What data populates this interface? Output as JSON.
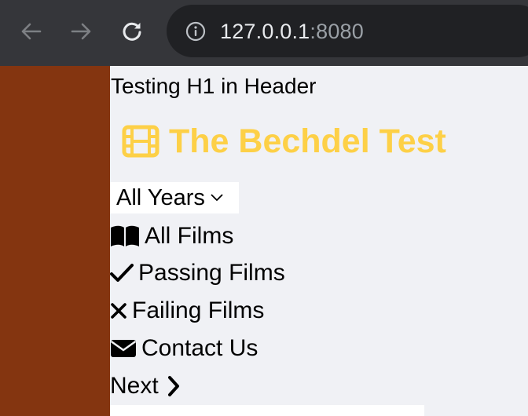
{
  "browser": {
    "url_host": "127.0.0.1",
    "url_port": ":8080"
  },
  "page": {
    "header_caption": "Testing H1 in Header",
    "site_title": "The Bechdel Test",
    "year_filter": {
      "selected": "All Years"
    },
    "menu": [
      {
        "label": "All Films",
        "icon": "book-open-icon"
      },
      {
        "label": "Passing Films",
        "icon": "check-icon"
      },
      {
        "label": "Failing Films",
        "icon": "x-mark-icon"
      },
      {
        "label": "Contact Us",
        "icon": "envelope-icon"
      },
      {
        "label": "Next",
        "icon": "chevron-right-icon"
      }
    ]
  },
  "colors": {
    "sidebar": "#843510",
    "title": "#fdd047",
    "background": "#f0f1f5",
    "chrome": "#35363a"
  }
}
